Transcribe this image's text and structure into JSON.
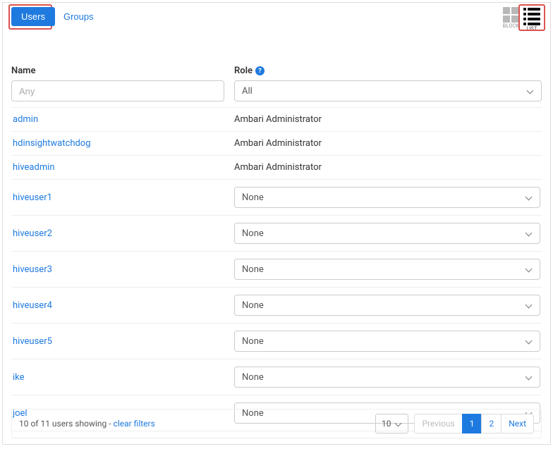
{
  "tabs": {
    "users": "Users",
    "groups": "Groups"
  },
  "viewToggle": {
    "block": "BLOCK",
    "list": "LIST"
  },
  "columns": {
    "name": "Name",
    "role": "Role"
  },
  "filters": {
    "namePlaceholder": "Any",
    "roleSelected": "All"
  },
  "roleNone": "None",
  "rows": [
    {
      "name": "admin",
      "role": "Ambari Administrator",
      "editable": false
    },
    {
      "name": "hdinsightwatchdog",
      "role": "Ambari Administrator",
      "editable": false
    },
    {
      "name": "hiveadmin",
      "role": "Ambari Administrator",
      "editable": false
    },
    {
      "name": "hiveuser1",
      "role": "None",
      "editable": true
    },
    {
      "name": "hiveuser2",
      "role": "None",
      "editable": true
    },
    {
      "name": "hiveuser3",
      "role": "None",
      "editable": true
    },
    {
      "name": "hiveuser4",
      "role": "None",
      "editable": true
    },
    {
      "name": "hiveuser5",
      "role": "None",
      "editable": true
    },
    {
      "name": "ike",
      "role": "None",
      "editable": true
    },
    {
      "name": "joel",
      "role": "None",
      "editable": true
    }
  ],
  "footer": {
    "summaryPrefix": "10 of 11 users showing - ",
    "clearFilters": "clear filters",
    "pageSize": "10",
    "previous": "Previous",
    "next": "Next",
    "pages": [
      "1",
      "2"
    ],
    "activePage": "1"
  }
}
